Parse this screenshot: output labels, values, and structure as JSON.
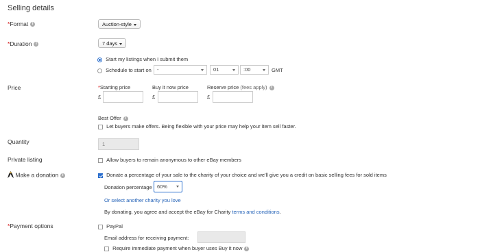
{
  "title": "Selling details",
  "format": {
    "label": "Format",
    "value": "Auction-style"
  },
  "duration": {
    "label": "Duration",
    "value": "7 days",
    "start_now": "Start my listings when I submit them",
    "schedule": "Schedule to start on",
    "date_value": "-",
    "hour_value": "01",
    "minute_value": ":00",
    "timezone": "GMT"
  },
  "price": {
    "label": "Price",
    "starting_label": "Starting price",
    "buy_now_label": "Buy it now price",
    "reserve_label": "Reserve price",
    "reserve_note": "(fees apply)",
    "currency": "£"
  },
  "best_offer": {
    "label": "Best Offer",
    "checkbox": "Let buyers make offers. Being flexible with your price may help your item sell faster."
  },
  "quantity": {
    "label": "Quantity",
    "value": "1"
  },
  "private_listing": {
    "label": "Private listing",
    "checkbox": "Allow buyers to remain anonymous to other eBay members"
  },
  "donation": {
    "label": "Make a donation",
    "checkbox": "Donate a percentage of your sale to the charity of your choice and we'll give you a credit on basic selling fees for sold items",
    "pct_label": "Donation percentage",
    "pct_value": "60%",
    "select_link": "Or select another charity you love",
    "terms_prefix": "By donating, you agree and accept the eBay for Charity ",
    "terms_link": "terms and conditions",
    "terms_suffix": "."
  },
  "payment": {
    "label": "Payment options",
    "paypal": "PayPal",
    "email_label": "Email address for receiving payment:",
    "immediate": "Require immediate payment when buyer uses Buy it now"
  },
  "colors": {
    "required": "#cc0000",
    "link": "#2563b8",
    "accent": "#2b6fce"
  }
}
